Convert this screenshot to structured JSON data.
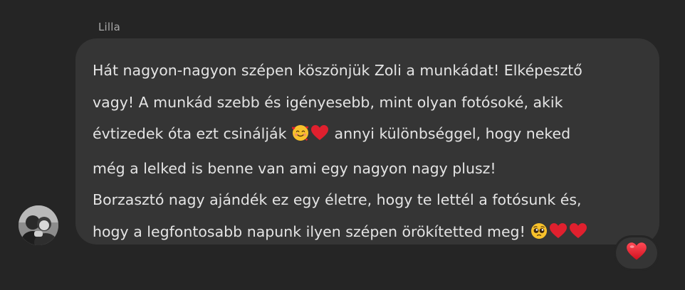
{
  "sender": {
    "name": "Lilla"
  },
  "message": {
    "lines": [
      "Hát nagyon-nagyon szépen köszönjük Zoli a munkádat! Elképesztő",
      "vagy! A munkád szebb és igényesebb, mint olyan fotósoké, akik",
      "évtizedek óta ezt csinálják",
      "annyi különbséggel, hogy neked",
      "még a lelked is benne van ami egy nagyon nagy plusz!",
      "Borzasztó nagy ajándék ez egy életre, hogy te lettél a fotósunk és,",
      "hogy a legfontosabb napunk ilyen szépen örökítetted meg!"
    ],
    "inline_icons": {
      "line3": [
        "smiling-face-with-hearts-icon",
        "red-heart-icon"
      ],
      "line7": [
        "pleading-face-icon",
        "red-heart-icon",
        "red-heart-icon"
      ]
    }
  },
  "reaction": {
    "icon": "red-heart-icon"
  },
  "colors": {
    "background": "#252525",
    "bubble": "#353535",
    "text": "#e4e4e4",
    "name": "#a8a8a8",
    "heart": "#e0202e",
    "emoji_yellow": "#f7c12b"
  }
}
